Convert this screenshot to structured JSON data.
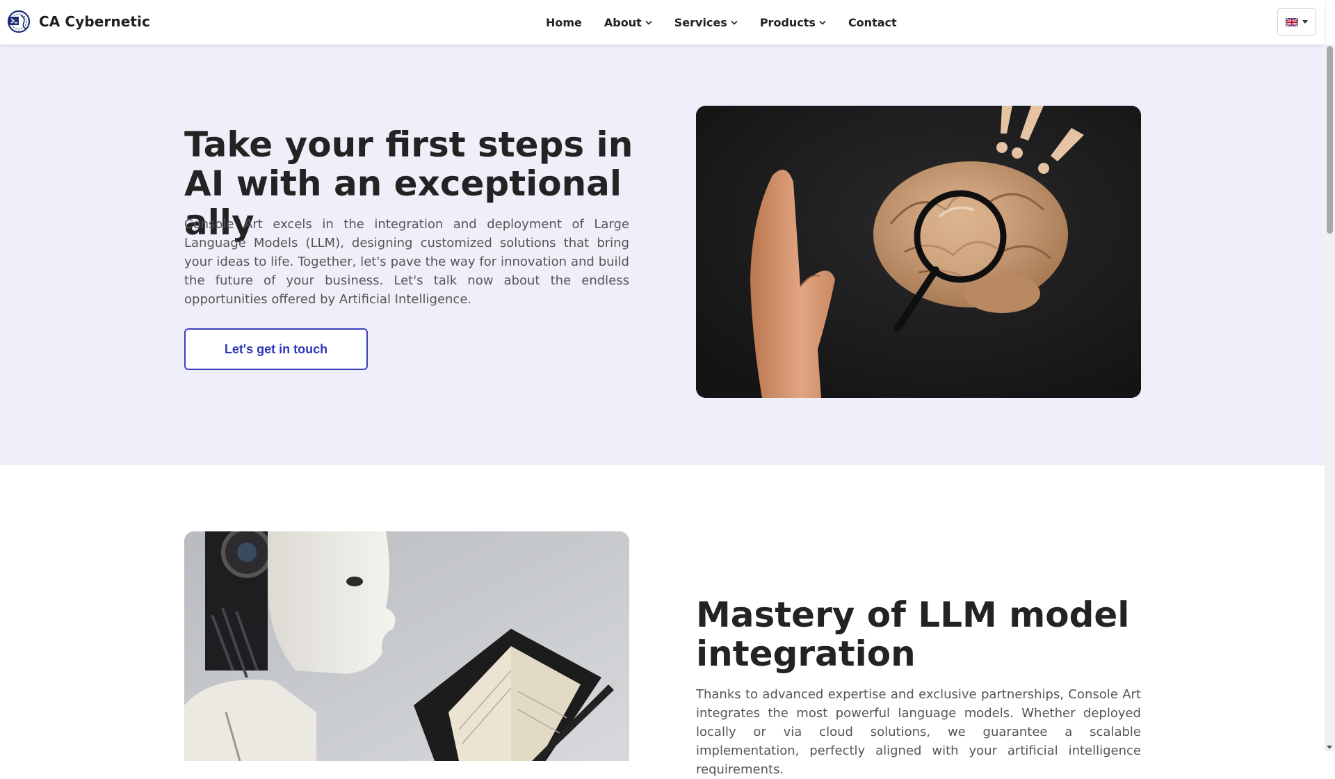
{
  "header": {
    "brand_name": "CA Cybernetic",
    "nav": [
      {
        "label": "Home",
        "has_dropdown": false
      },
      {
        "label": "About",
        "has_dropdown": true
      },
      {
        "label": "Services",
        "has_dropdown": true
      },
      {
        "label": "Products",
        "has_dropdown": true
      },
      {
        "label": "Contact",
        "has_dropdown": false
      }
    ],
    "language_icon": "uk-flag-icon"
  },
  "hero": {
    "title": "Take your first steps in AI with an exceptional ally",
    "text": "Console Art excels in the integration and deployment of Large Language Models (LLM), designing customized solutions that bring your ideas to life. Together, let's pave the way for innovation and build the future of your business. Let's talk now about the endless opportunities offered by Artificial Intelligence.",
    "cta_label": "Let's get in touch",
    "image_icon": "brain-magnifier-image"
  },
  "section2": {
    "title": "Mastery of LLM model integration",
    "text": "Thanks to advanced expertise and exclusive partnerships, Console Art integrates the most powerful language models. Whether deployed locally or via cloud solutions, we guarantee a scalable implementation, perfectly aligned with your artificial intelligence requirements.",
    "image_icon": "robot-notebook-image"
  },
  "colors": {
    "accent": "#2f35b6",
    "hero_background": "#efeff9"
  }
}
